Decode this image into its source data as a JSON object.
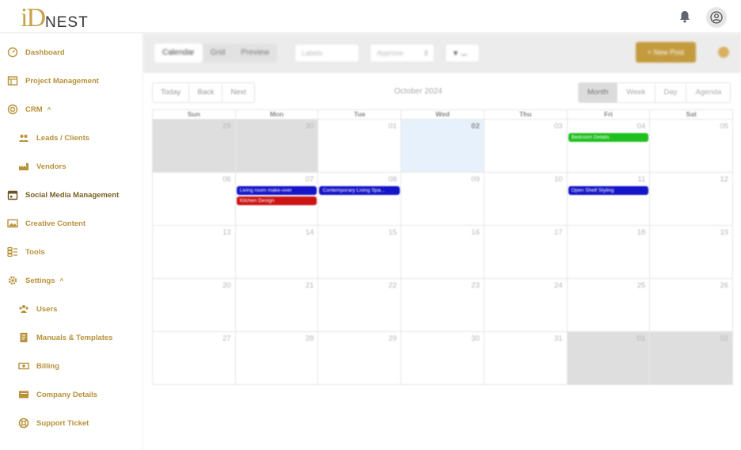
{
  "brand": {
    "mark": "iD",
    "name": "NEST",
    "accent": "#c9a24a"
  },
  "sidebar": {
    "items": [
      {
        "label": "Dashboard",
        "icon": "dashboard-icon"
      },
      {
        "label": "Project Management",
        "icon": "table-icon"
      },
      {
        "label": "CRM",
        "icon": "target-icon",
        "caret": "^"
      },
      {
        "label": "Leads / Clients",
        "icon": "people-icon"
      },
      {
        "label": "Vendors",
        "icon": "factory-icon"
      },
      {
        "label": "Social Media Management",
        "icon": "calendar-icon"
      },
      {
        "label": "Creative Content",
        "icon": "image-icon"
      },
      {
        "label": "Tools",
        "icon": "tools-icon"
      },
      {
        "label": "Settings",
        "icon": "gear-icon",
        "caret": "^"
      },
      {
        "label": "Users",
        "icon": "users-icon"
      },
      {
        "label": "Manuals & Templates",
        "icon": "document-icon"
      },
      {
        "label": "Billing",
        "icon": "money-icon"
      },
      {
        "label": "Company Details",
        "icon": "folder-icon"
      },
      {
        "label": "Support Ticket",
        "icon": "lifebuoy-icon"
      }
    ]
  },
  "toolbar": {
    "tabs": [
      "Calendar",
      "Grid",
      "Preview"
    ],
    "labels_placeholder": "Labels",
    "approve_placeholder": "Approve",
    "filter_label": "...",
    "new_post": "+ New Post"
  },
  "calendar": {
    "nav": [
      "Today",
      "Back",
      "Next"
    ],
    "month_label": "October 2024",
    "views": [
      "Month",
      "Week",
      "Day",
      "Agenda"
    ],
    "active_view": "Month",
    "weekdays": [
      "Sun",
      "Mon",
      "Tue",
      "Wed",
      "Thu",
      "Fri",
      "Sat"
    ],
    "weeks": [
      [
        "29",
        "30",
        "01",
        "02",
        "03",
        "04",
        "05"
      ],
      [
        "06",
        "07",
        "08",
        "09",
        "10",
        "11",
        "12"
      ],
      [
        "13",
        "14",
        "15",
        "16",
        "17",
        "18",
        "19"
      ],
      [
        "20",
        "21",
        "22",
        "23",
        "24",
        "25",
        "26"
      ],
      [
        "27",
        "28",
        "29",
        "30",
        "31",
        "01",
        "02"
      ]
    ],
    "events": [
      {
        "title": "Bedroom Details",
        "week": 0,
        "day": 5,
        "slot": 0,
        "color": "#1fbf1f"
      },
      {
        "title": "Living room make-over",
        "week": 1,
        "day": 1,
        "slot": 0,
        "color": "#1414c8"
      },
      {
        "title": "Kitchen Design",
        "week": 1,
        "day": 1,
        "slot": 1,
        "color": "#cc1414"
      },
      {
        "title": "Contemporary Living Spa...",
        "week": 1,
        "day": 2,
        "slot": 0,
        "color": "#1414c8"
      },
      {
        "title": "Open Shelf Styling",
        "week": 1,
        "day": 5,
        "slot": 0,
        "color": "#1414c8"
      }
    ]
  }
}
